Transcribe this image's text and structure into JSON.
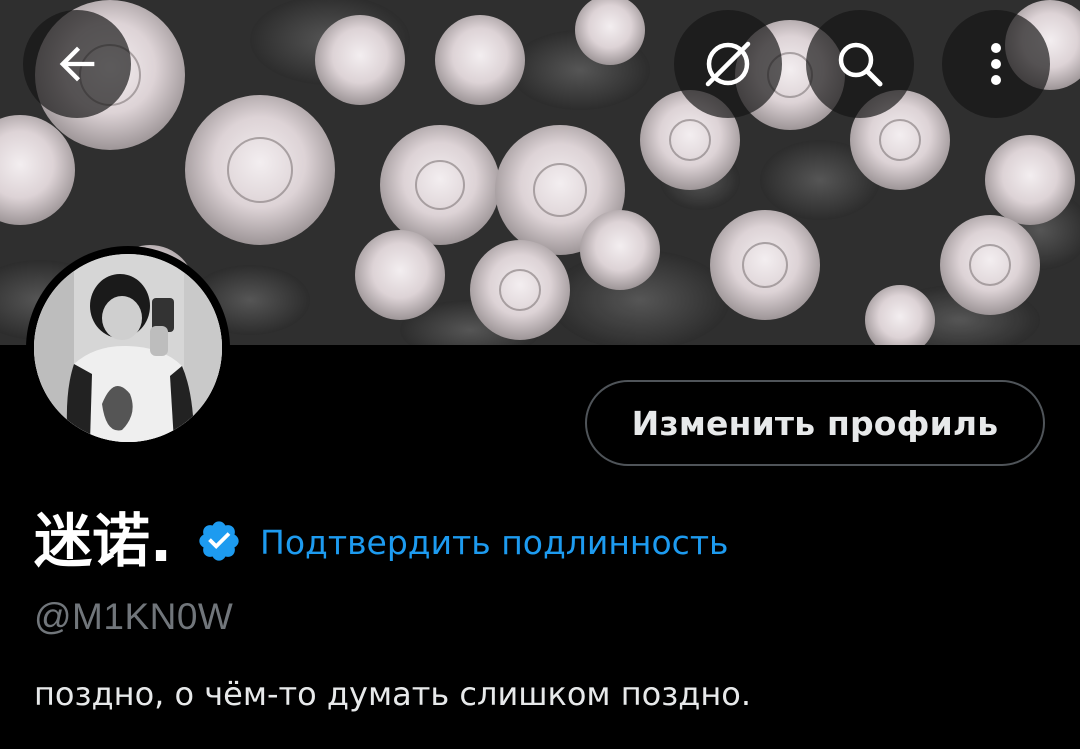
{
  "header": {
    "back_icon": "arrow-left-icon",
    "grok_icon": "grok-icon",
    "search_icon": "search-icon",
    "more_icon": "more-vertical-icon"
  },
  "banner": {
    "description_icon": "roses-banner-image"
  },
  "profile": {
    "edit_button_label": "Изменить профиль",
    "display_name": "迷诺.",
    "verify_link": "Подтвердить подлинность",
    "handle": "@M1KN0W",
    "bio": "поздно, о чём-то думать слишком поздно."
  },
  "colors": {
    "background": "#000000",
    "accent": "#1d9bf0",
    "secondary_text": "#71767b",
    "primary_text": "#e7e9ea",
    "button_border": "#4f5459"
  }
}
